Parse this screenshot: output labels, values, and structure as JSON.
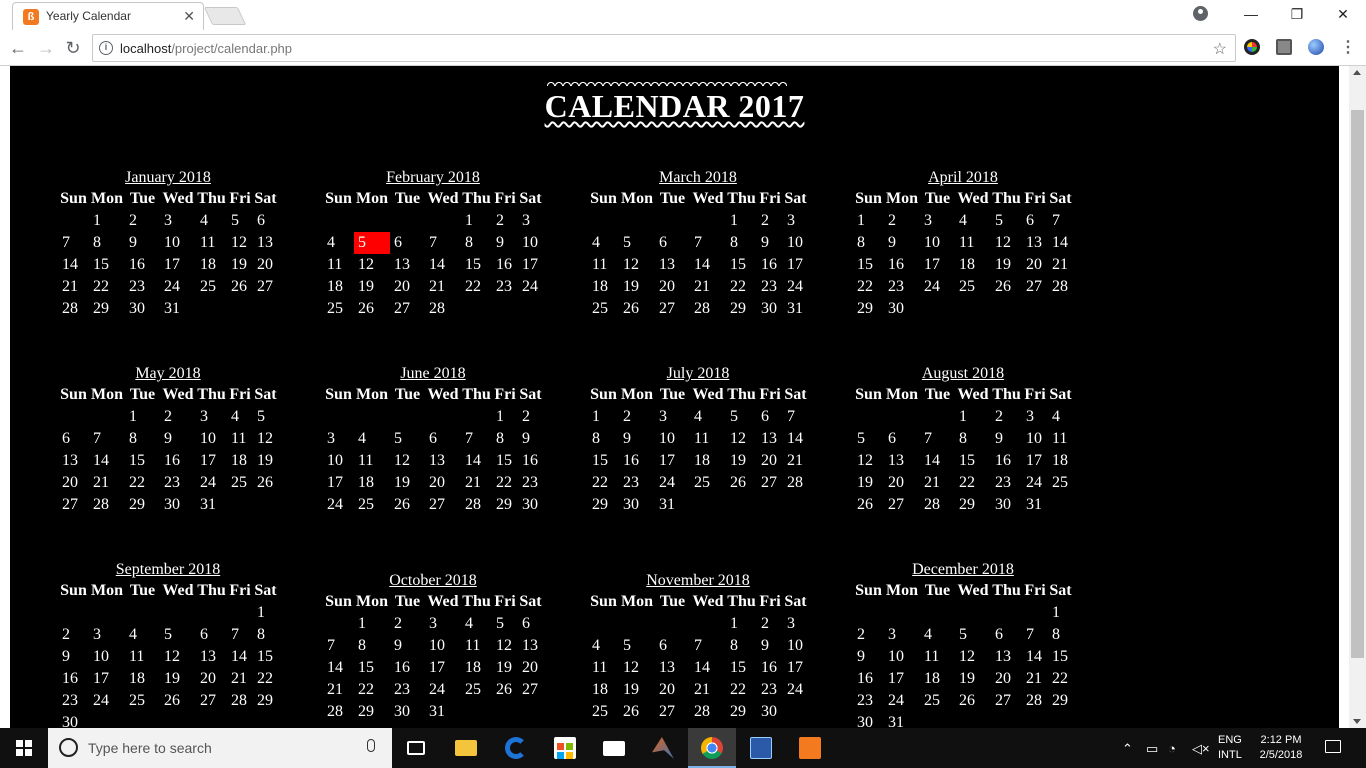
{
  "browser": {
    "tab_title": "Yearly Calendar",
    "tab_favicon_letter": "ß",
    "close_glyph": "✕",
    "url_host": "localhost",
    "url_path": "/project/calendar.php",
    "minimize_glyph": "—",
    "restore_glyph": "❐",
    "window_close_glyph": "✕",
    "back_glyph": "←",
    "forward_glyph": "→",
    "reload_glyph": "↻",
    "info_glyph": "i",
    "star_glyph": "☆",
    "menu_glyph": "⋮"
  },
  "page": {
    "title": "CALENDAR 2017",
    "day_headers": [
      "Sun",
      "Mon",
      "Tue",
      "Wed",
      "Thu",
      "Fri",
      "Sat"
    ],
    "highlight": {
      "month": "February 2018",
      "day": "5",
      "color": "#ff0000"
    },
    "months": [
      {
        "name": "January 2018",
        "weeks": [
          [
            "",
            "1",
            "2",
            "3",
            "4",
            "5",
            "6"
          ],
          [
            "7",
            "8",
            "9",
            "10",
            "11",
            "12",
            "13"
          ],
          [
            "14",
            "15",
            "16",
            "17",
            "18",
            "19",
            "20"
          ],
          [
            "21",
            "22",
            "23",
            "24",
            "25",
            "26",
            "27"
          ],
          [
            "28",
            "29",
            "30",
            "31",
            "",
            "",
            ""
          ]
        ]
      },
      {
        "name": "February 2018",
        "weeks": [
          [
            "",
            "",
            "",
            "",
            "1",
            "2",
            "3"
          ],
          [
            "4",
            "5",
            "6",
            "7",
            "8",
            "9",
            "10"
          ],
          [
            "11",
            "12",
            "13",
            "14",
            "15",
            "16",
            "17"
          ],
          [
            "18",
            "19",
            "20",
            "21",
            "22",
            "23",
            "24"
          ],
          [
            "25",
            "26",
            "27",
            "28",
            "",
            "",
            ""
          ]
        ]
      },
      {
        "name": "March 2018",
        "weeks": [
          [
            "",
            "",
            "",
            "",
            "1",
            "2",
            "3"
          ],
          [
            "4",
            "5",
            "6",
            "7",
            "8",
            "9",
            "10"
          ],
          [
            "11",
            "12",
            "13",
            "14",
            "15",
            "16",
            "17"
          ],
          [
            "18",
            "19",
            "20",
            "21",
            "22",
            "23",
            "24"
          ],
          [
            "25",
            "26",
            "27",
            "28",
            "29",
            "30",
            "31"
          ]
        ]
      },
      {
        "name": "April 2018",
        "weeks": [
          [
            "1",
            "2",
            "3",
            "4",
            "5",
            "6",
            "7"
          ],
          [
            "8",
            "9",
            "10",
            "11",
            "12",
            "13",
            "14"
          ],
          [
            "15",
            "16",
            "17",
            "18",
            "19",
            "20",
            "21"
          ],
          [
            "22",
            "23",
            "24",
            "25",
            "26",
            "27",
            "28"
          ],
          [
            "29",
            "30",
            "",
            "",
            "",
            "",
            ""
          ]
        ]
      },
      {
        "name": "May 2018",
        "weeks": [
          [
            "",
            "",
            "1",
            "2",
            "3",
            "4",
            "5"
          ],
          [
            "6",
            "7",
            "8",
            "9",
            "10",
            "11",
            "12"
          ],
          [
            "13",
            "14",
            "15",
            "16",
            "17",
            "18",
            "19"
          ],
          [
            "20",
            "21",
            "22",
            "23",
            "24",
            "25",
            "26"
          ],
          [
            "27",
            "28",
            "29",
            "30",
            "31",
            "",
            ""
          ]
        ]
      },
      {
        "name": "June 2018",
        "weeks": [
          [
            "",
            "",
            "",
            "",
            "",
            "1",
            "2"
          ],
          [
            "3",
            "4",
            "5",
            "6",
            "7",
            "8",
            "9"
          ],
          [
            "10",
            "11",
            "12",
            "13",
            "14",
            "15",
            "16"
          ],
          [
            "17",
            "18",
            "19",
            "20",
            "21",
            "22",
            "23"
          ],
          [
            "24",
            "25",
            "26",
            "27",
            "28",
            "29",
            "30"
          ]
        ]
      },
      {
        "name": "July 2018",
        "weeks": [
          [
            "1",
            "2",
            "3",
            "4",
            "5",
            "6",
            "7"
          ],
          [
            "8",
            "9",
            "10",
            "11",
            "12",
            "13",
            "14"
          ],
          [
            "15",
            "16",
            "17",
            "18",
            "19",
            "20",
            "21"
          ],
          [
            "22",
            "23",
            "24",
            "25",
            "26",
            "27",
            "28"
          ],
          [
            "29",
            "30",
            "31",
            "",
            "",
            "",
            ""
          ]
        ]
      },
      {
        "name": "August 2018",
        "weeks": [
          [
            "",
            "",
            "",
            "1",
            "2",
            "3",
            "4"
          ],
          [
            "5",
            "6",
            "7",
            "8",
            "9",
            "10",
            "11"
          ],
          [
            "12",
            "13",
            "14",
            "15",
            "16",
            "17",
            "18"
          ],
          [
            "19",
            "20",
            "21",
            "22",
            "23",
            "24",
            "25"
          ],
          [
            "26",
            "27",
            "28",
            "29",
            "30",
            "31",
            ""
          ]
        ]
      },
      {
        "name": "September 2018",
        "weeks": [
          [
            "",
            "",
            "",
            "",
            "",
            "",
            "1"
          ],
          [
            "2",
            "3",
            "4",
            "5",
            "6",
            "7",
            "8"
          ],
          [
            "9",
            "10",
            "11",
            "12",
            "13",
            "14",
            "15"
          ],
          [
            "16",
            "17",
            "18",
            "19",
            "20",
            "21",
            "22"
          ],
          [
            "23",
            "24",
            "25",
            "26",
            "27",
            "28",
            "29"
          ],
          [
            "30",
            "",
            "",
            "",
            "",
            "",
            ""
          ]
        ]
      },
      {
        "name": "October 2018",
        "weeks": [
          [
            "",
            "1",
            "2",
            "3",
            "4",
            "5",
            "6"
          ],
          [
            "7",
            "8",
            "9",
            "10",
            "11",
            "12",
            "13"
          ],
          [
            "14",
            "15",
            "16",
            "17",
            "18",
            "19",
            "20"
          ],
          [
            "21",
            "22",
            "23",
            "24",
            "25",
            "26",
            "27"
          ],
          [
            "28",
            "29",
            "30",
            "31",
            "",
            "",
            ""
          ]
        ]
      },
      {
        "name": "November 2018",
        "weeks": [
          [
            "",
            "",
            "",
            "",
            "1",
            "2",
            "3"
          ],
          [
            "4",
            "5",
            "6",
            "7",
            "8",
            "9",
            "10"
          ],
          [
            "11",
            "12",
            "13",
            "14",
            "15",
            "16",
            "17"
          ],
          [
            "18",
            "19",
            "20",
            "21",
            "22",
            "23",
            "24"
          ],
          [
            "25",
            "26",
            "27",
            "28",
            "29",
            "30",
            ""
          ]
        ]
      },
      {
        "name": "December 2018",
        "weeks": [
          [
            "",
            "",
            "",
            "",
            "",
            "",
            "1"
          ],
          [
            "2",
            "3",
            "4",
            "5",
            "6",
            "7",
            "8"
          ],
          [
            "9",
            "10",
            "11",
            "12",
            "13",
            "14",
            "15"
          ],
          [
            "16",
            "17",
            "18",
            "19",
            "20",
            "21",
            "22"
          ],
          [
            "23",
            "24",
            "25",
            "26",
            "27",
            "28",
            "29"
          ],
          [
            "30",
            "31",
            "",
            "",
            "",
            "",
            ""
          ]
        ]
      }
    ]
  },
  "taskbar": {
    "search_placeholder": "Type here to search",
    "lang_line1": "ENG",
    "lang_line2": "INTL",
    "time": "2:12 PM",
    "date": "2/5/2018",
    "apps": [
      "task-view-icon",
      "file-explorer-icon",
      "edge-icon",
      "store-icon",
      "mail-icon",
      "matlab-icon",
      "chrome-icon",
      "devcpp-icon",
      "xampp-icon"
    ]
  }
}
